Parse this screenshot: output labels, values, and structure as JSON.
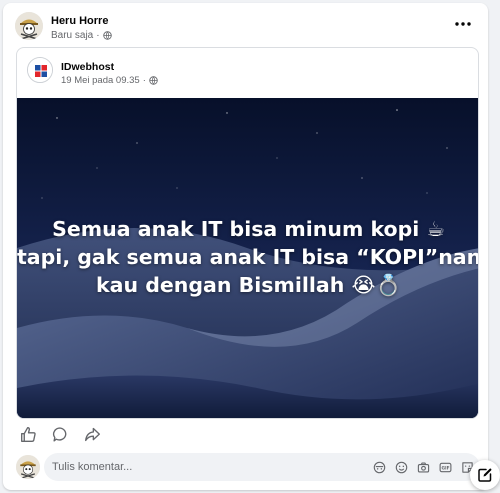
{
  "post": {
    "author": "Heru Horre",
    "time": "Baru saja",
    "privacy_icon": "globe-icon",
    "more_icon": "more-horizontal-icon"
  },
  "shared_post": {
    "page_name": "IDwebhost",
    "date": "19 Mei pada 09.35",
    "privacy_icon": "globe-icon",
    "image": {
      "caption_lines": [
        "Semua anak IT bisa minum kopi ☕",
        "tapi, gak semua anak IT bisa “KOPI”nang",
        "kau dengan Bismillah 😭💍"
      ],
      "background_colors": [
        "#0b1530",
        "#1c2a4f",
        "#3a4a72"
      ]
    }
  },
  "actions": {
    "like_icon": "like-icon",
    "comment_icon": "comment-icon",
    "share_icon": "share-icon"
  },
  "comment": {
    "placeholder": "Tulis komentar...",
    "icons": [
      "avatar-sticker-icon",
      "emoji-icon",
      "camera-icon",
      "gif-icon",
      "sticker-icon"
    ]
  },
  "colors": {
    "text_primary": "#050505",
    "text_secondary": "#65676b",
    "card_bg": "#ffffff",
    "page_bg": "#f0f2f5",
    "input_bg": "#f0f2f5"
  }
}
